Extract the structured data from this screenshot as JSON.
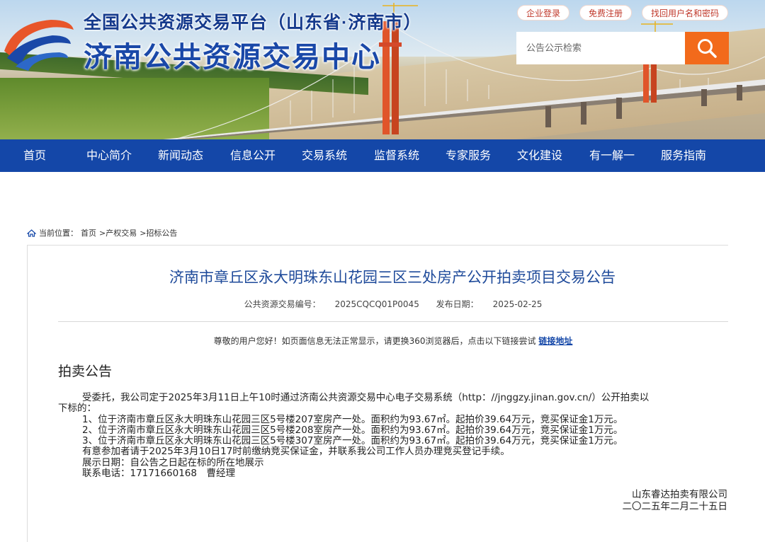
{
  "header": {
    "platform_title": "全国公共资源交易平台（山东省·济南市）",
    "site_title": "济南公共资源交易中心",
    "top_links": [
      "企业登录",
      "免费注册",
      "找回用户名和密码"
    ],
    "search": {
      "placeholder": "公告公示检索"
    }
  },
  "nav": [
    "首页",
    "中心简介",
    "新闻动态",
    "信息公开",
    "交易系统",
    "监督系统",
    "专家服务",
    "文化建设",
    "有一解一",
    "服务指南"
  ],
  "breadcrumb": {
    "label": "当前位置：",
    "items": [
      "首页",
      ">产权交易",
      ">招标公告"
    ]
  },
  "article": {
    "title": "济南市章丘区永大明珠东山花园三区三处房产公开拍卖项目交易公告",
    "code_label": "公共资源交易编号：",
    "code": "2025CQCQ01P0045",
    "date_label": "发布日期：",
    "date": "2025-02-25",
    "browser_notice": "尊敬的用户您好！如页面信息无法正常显示，请更换360浏览器后，点击以下链接尝试",
    "link_text": "链接地址",
    "section_heading": "拍卖公告",
    "intro_line1": "受委托，我公司定于2025年3月11日上午10时通过济南公共资源交易中心电子交易系统（http：//jnggzy.jinan.gov.cn/）公开拍卖以",
    "intro_line2": "下标的：",
    "items": [
      "1、位于济南市章丘区永大明珠东山花园三区5号楼207室房产一处。面积约为93.67㎡。起拍价39.64万元，竞买保证金1万元。",
      "2、位于济南市章丘区永大明珠东山花园三区5号楼208室房产一处。面积约为93.67㎡。起拍价39.64万元，竞买保证金1万元。",
      "3、位于济南市章丘区永大明珠东山花园三区5号楼307室房产一处。面积约为93.67㎡。起拍价39.64万元，竞买保证金1万元。"
    ],
    "deposit_note": "有意参加者请于2025年3月10日17时前缴纳竞买保证金，并联系我公司工作人员办理竞买登记手续。",
    "exhibit": "展示日期：自公告之日起在标的所在地展示",
    "contact": "联系电话：17171660168　曹经理",
    "company": "山东睿达拍卖有限公司",
    "sign_date": "二〇二五年二月二十五日"
  },
  "colors": {
    "nav_bg": "#1447a8",
    "search_button": "#f26a1b",
    "title_blue": "#1e4a9a",
    "pill_text": "#c0392b"
  }
}
